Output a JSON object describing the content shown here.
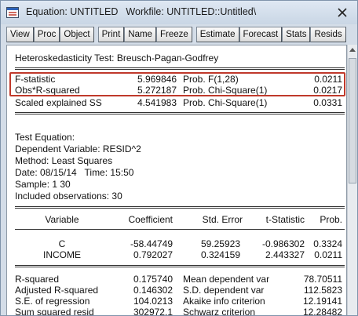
{
  "window": {
    "title": "Equation: UNTITLED",
    "workfile": "Workfile: UNTITLED::Untitled\\"
  },
  "toolbar": {
    "view": "View",
    "proc": "Proc",
    "object": "Object",
    "print": "Print",
    "name": "Name",
    "freeze": "Freeze",
    "estimate": "Estimate",
    "forecast": "Forecast",
    "stats": "Stats",
    "resids": "Resids"
  },
  "header": {
    "test_title": "Heteroskedasticity Test: Breusch-Pagan-Godfrey"
  },
  "tests": [
    {
      "label": "F-statistic",
      "value": "5.969846",
      "prob_label": "Prob. F(1,28)",
      "prob": "0.0211"
    },
    {
      "label": "Obs*R-squared",
      "value": "5.272187",
      "prob_label": "Prob. Chi-Square(1)",
      "prob": "0.0217"
    },
    {
      "label": "Scaled explained SS",
      "value": "4.541983",
      "prob_label": "Prob. Chi-Square(1)",
      "prob": "0.0331"
    }
  ],
  "equation_info": {
    "heading": "Test Equation:",
    "dependent": "Dependent Variable: RESID^2",
    "method": "Method: Least Squares",
    "date": "Date: 08/15/14   Time: 15:50",
    "sample": "Sample: 1 30",
    "observations": "Included observations: 30"
  },
  "coef_table": {
    "headers": {
      "variable": "Variable",
      "coefficient": "Coefficient",
      "std_error": "Std. Error",
      "t_stat": "t-Statistic",
      "prob": "Prob."
    },
    "rows": [
      {
        "variable": "C",
        "coefficient": "-58.44749",
        "std_error": "59.25923",
        "t_stat": "-0.986302",
        "prob": "0.3324"
      },
      {
        "variable": "INCOME",
        "coefficient": "0.792027",
        "std_error": "0.324159",
        "t_stat": "2.443327",
        "prob": "0.0211"
      }
    ]
  },
  "stats": [
    {
      "label": "R-squared",
      "value": "0.175740",
      "label2": "Mean dependent var",
      "value2": "78.70511"
    },
    {
      "label": "Adjusted R-squared",
      "value": "0.146302",
      "label2": "S.D. dependent var",
      "value2": "112.5823"
    },
    {
      "label": "S.E. of regression",
      "value": "104.0213",
      "label2": "Akaike info criterion",
      "value2": "12.19141"
    },
    {
      "label": "Sum squared resid",
      "value": "302972.1",
      "label2": "Schwarz criterion",
      "value2": "12.28482"
    }
  ],
  "colors": {
    "highlight": "#c0392b",
    "chrome": "#d4dde8"
  },
  "icons": {
    "app": "eviews-equation-icon",
    "close": "close-icon",
    "scroll_up": "scroll-up-arrow-icon"
  }
}
